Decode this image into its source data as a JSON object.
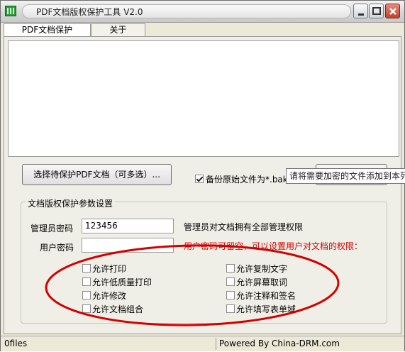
{
  "window": {
    "title": "PDF文档版权保护工具 V2.0"
  },
  "tabs": [
    {
      "label": "PDF文档保护",
      "active": true
    },
    {
      "label": "关于",
      "active": false
    }
  ],
  "actions": {
    "select_files_label": "选择待保护PDF文档（可多选）...",
    "backup_label": "备份原始文件为*.bak",
    "backup_checked": true,
    "tooltip": "请将需要加密的文件添加到本列表"
  },
  "settings": {
    "group_title": "文档版权保护参数设置",
    "admin_password_label": "管理员密码",
    "admin_password_value": "123456",
    "admin_note": "管理员对文档拥有全部管理权限",
    "user_password_label": "用户密码",
    "user_password_value": "",
    "user_note": "用户密码可留空，可以设置用户对文档的权限：",
    "permissions_left": [
      {
        "label": "允许打印",
        "checked": false
      },
      {
        "label": "允许低质量打印",
        "checked": false
      },
      {
        "label": "允许修改",
        "checked": false
      },
      {
        "label": "允许文档组合",
        "checked": false
      }
    ],
    "permissions_right": [
      {
        "label": "允许复制文字",
        "checked": false
      },
      {
        "label": "允许屏幕取词",
        "checked": false
      },
      {
        "label": "允许注释和签名",
        "checked": false
      },
      {
        "label": "允许填写表单域",
        "checked": false
      }
    ]
  },
  "status": {
    "file_count": "0files",
    "powered_by": "Powered By China-DRM.com"
  },
  "colors": {
    "annotation_red": "#d40000",
    "title_gradient_top": "#f3f3f3",
    "close_button": "#c2412c"
  }
}
